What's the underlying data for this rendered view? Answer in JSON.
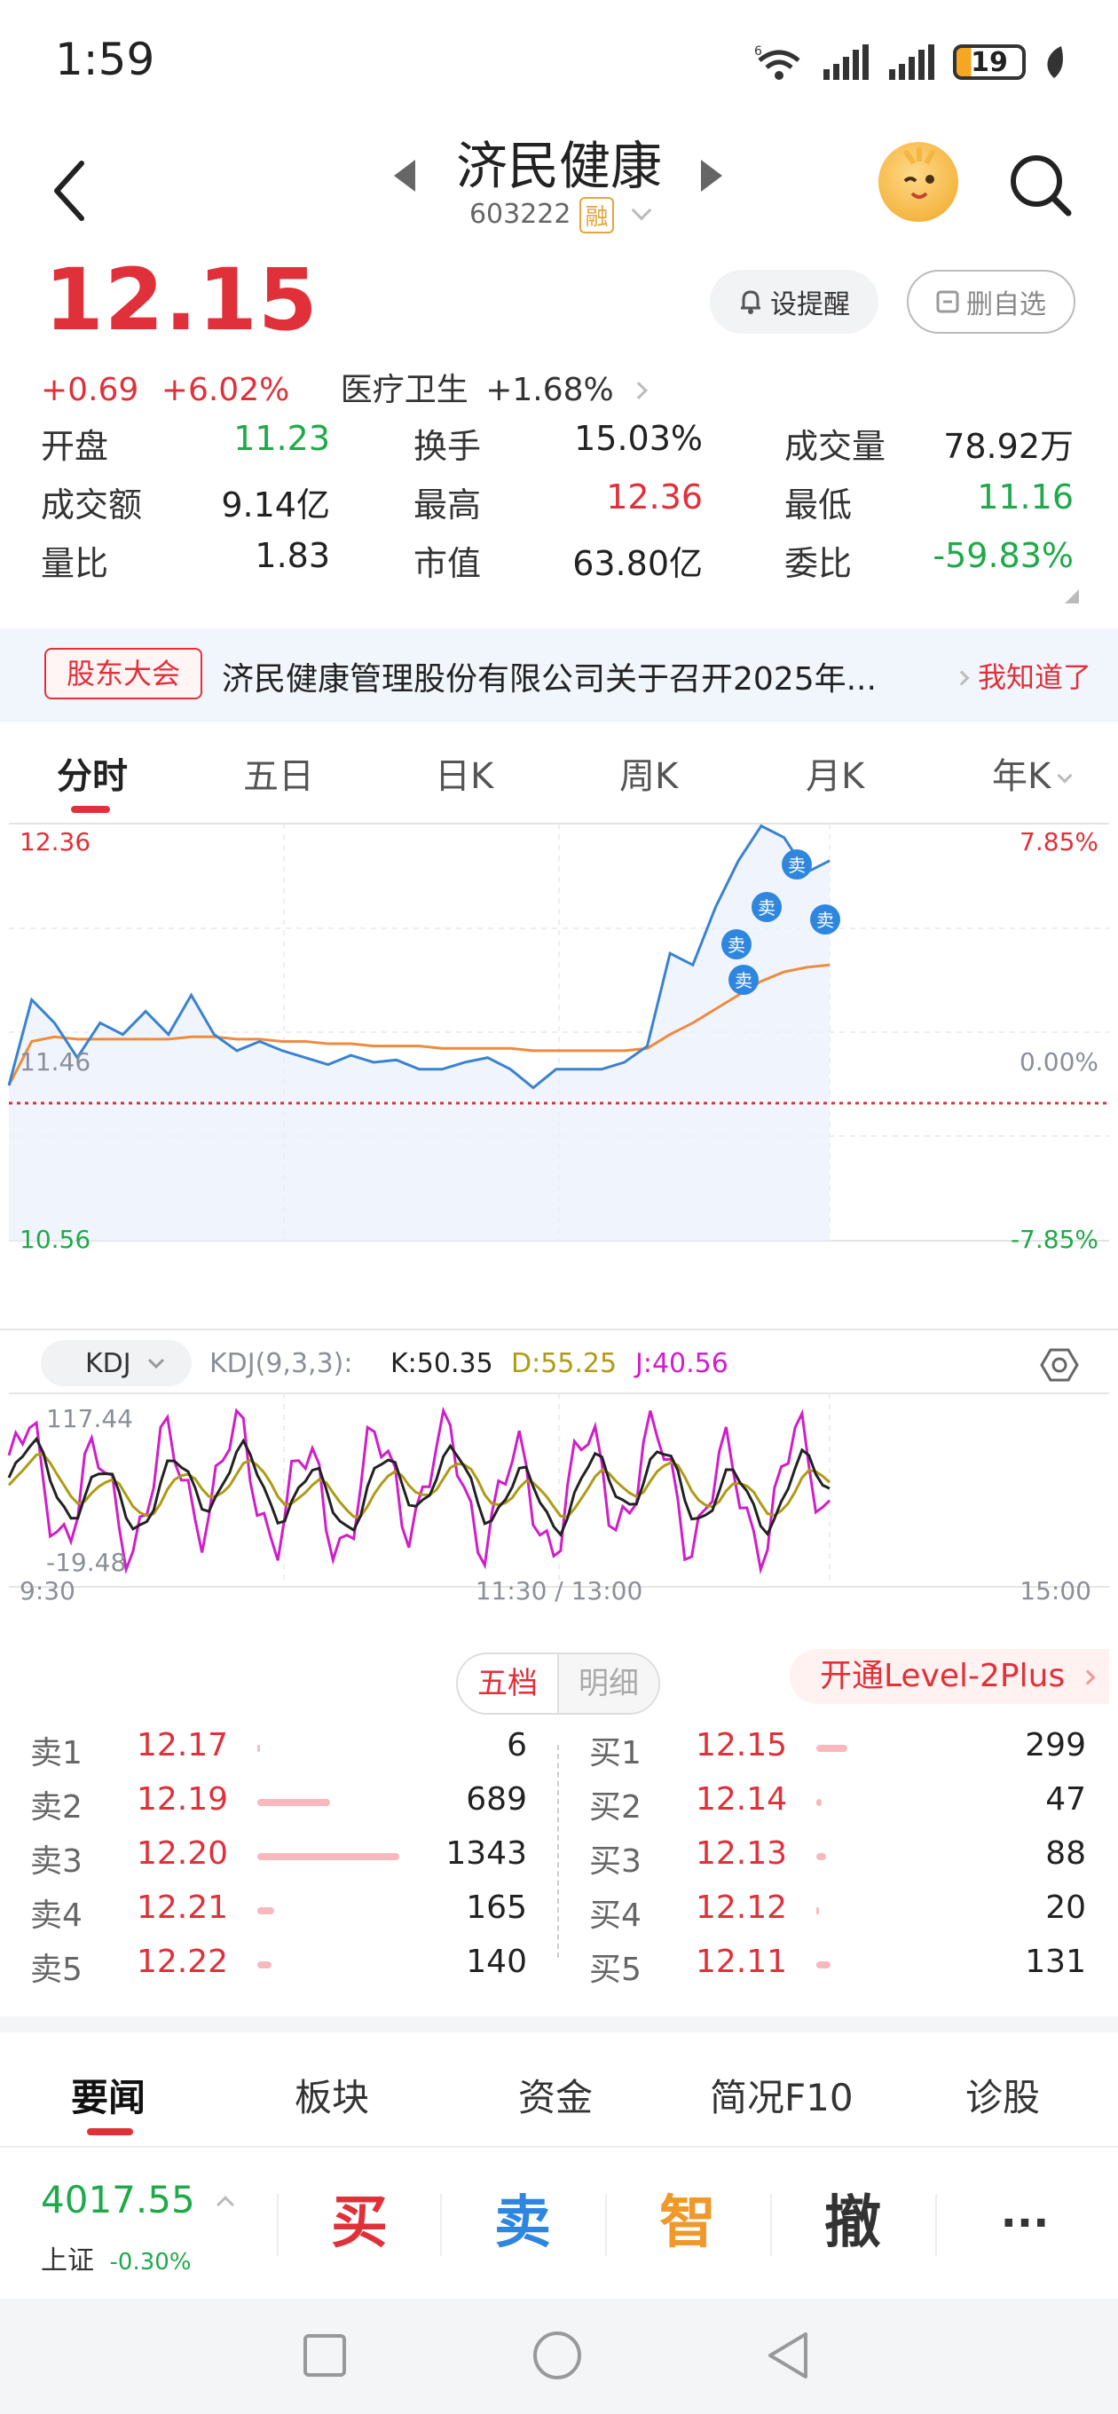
{
  "status_bar": {
    "time": "1:59",
    "network": "6",
    "battery": "19"
  },
  "header": {
    "title": "济民健康",
    "code": "603222",
    "margin_tag": "融"
  },
  "quote": {
    "price": "12.15",
    "change": "+0.69",
    "change_pct": "+6.02%",
    "sector": "医疗卫生",
    "sector_change": "+1.68%",
    "remind_label": "设提醒",
    "delete_label": "删自选"
  },
  "stats": [
    [
      {
        "label": "开盘",
        "value": "11.23",
        "color": "green"
      },
      {
        "label": "换手",
        "value": "15.03%",
        "color": "black"
      },
      {
        "label": "成交量",
        "value": "78.92万",
        "color": "black"
      }
    ],
    [
      {
        "label": "成交额",
        "value": "9.14亿",
        "color": "black"
      },
      {
        "label": "最高",
        "value": "12.36",
        "color": "red"
      },
      {
        "label": "最低",
        "value": "11.16",
        "color": "green"
      }
    ],
    [
      {
        "label": "量比",
        "value": "1.83",
        "color": "black"
      },
      {
        "label": "市值",
        "value": "63.80亿",
        "color": "black"
      },
      {
        "label": "委比",
        "value": "-59.83%",
        "color": "green"
      }
    ]
  ],
  "notice": {
    "tag": "股东大会",
    "text": "济民健康管理股份有限公司关于召开2025年...",
    "ack": "我知道了"
  },
  "period_tabs": [
    "分时",
    "五日",
    "日K",
    "周K",
    "月K",
    "年K"
  ],
  "chart": {
    "price_high": "12.36",
    "price_low": "10.56",
    "pct_high": "7.85%",
    "pct_low": "-7.85%",
    "pct_mid": "0.00%",
    "mid_price": "11.46",
    "indicator_name": "KDJ",
    "indicator_params": "KDJ(9,3,3):",
    "k_text": "K:50.35",
    "d_text": "D:55.25",
    "j_text": "J:40.56",
    "kdj_high": "117.44",
    "kdj_low": "-19.48",
    "time_start": "9:30",
    "time_mid": "11:30 / 13:00",
    "time_end": "15:00",
    "sell_marker": "卖"
  },
  "chart_data": {
    "type": "line",
    "title": "",
    "x_range": [
      "9:30",
      "15:00"
    ],
    "ylim": [
      10.56,
      12.36
    ],
    "prev_close": 11.46,
    "series": [
      {
        "name": "",
        "values": [
          11.23,
          11.6,
          11.5,
          11.35,
          11.5,
          11.45,
          11.55,
          11.45,
          11.62,
          11.45,
          11.38,
          11.42,
          11.38,
          11.35,
          11.32,
          11.36,
          11.33,
          11.34,
          11.3,
          11.3,
          11.33,
          11.35,
          11.3,
          11.22,
          11.3,
          11.3,
          11.3,
          11.33,
          11.4,
          11.8,
          11.75,
          12.0,
          12.2,
          12.35,
          12.3,
          12.15,
          12.2
        ]
      },
      {
        "name": "",
        "values": [
          11.23,
          11.42,
          11.44,
          11.43,
          11.43,
          11.43,
          11.43,
          11.43,
          11.44,
          11.44,
          11.43,
          11.43,
          11.42,
          11.42,
          11.41,
          11.41,
          11.4,
          11.4,
          11.4,
          11.39,
          11.39,
          11.39,
          11.39,
          11.38,
          11.38,
          11.38,
          11.38,
          11.38,
          11.39,
          11.45,
          11.5,
          11.56,
          11.62,
          11.68,
          11.72,
          11.74,
          11.75
        ]
      }
    ],
    "kdj": {
      "K": 50.35,
      "D": 55.25,
      "J": 40.56,
      "ylim": [
        -19.48,
        117.44
      ]
    }
  },
  "order_book": {
    "tab_active": "五档",
    "tab_other": "明细",
    "level2": "开通Level-2Plus",
    "sells": [
      {
        "label": "卖1",
        "price": "12.17",
        "volume": "6",
        "bar": 0.005
      },
      {
        "label": "卖2",
        "price": "12.19",
        "volume": "689",
        "bar": 0.51
      },
      {
        "label": "卖3",
        "price": "12.20",
        "volume": "1343",
        "bar": 1.0
      },
      {
        "label": "卖4",
        "price": "12.21",
        "volume": "165",
        "bar": 0.12
      },
      {
        "label": "卖5",
        "price": "12.22",
        "volume": "140",
        "bar": 0.1
      }
    ],
    "buys": [
      {
        "label": "买1",
        "price": "12.15",
        "volume": "299",
        "bar": 0.22
      },
      {
        "label": "买2",
        "price": "12.14",
        "volume": "47",
        "bar": 0.035
      },
      {
        "label": "买3",
        "price": "12.13",
        "volume": "88",
        "bar": 0.066
      },
      {
        "label": "买4",
        "price": "12.12",
        "volume": "20",
        "bar": 0.015
      },
      {
        "label": "买5",
        "price": "12.11",
        "volume": "131",
        "bar": 0.098
      }
    ]
  },
  "news_tabs": [
    "要闻",
    "板块",
    "资金",
    "简况F10",
    "诊股"
  ],
  "trade_bar": {
    "index_value": "4017.55",
    "index_name": "上证",
    "index_change": "-0.30%",
    "buy": "买",
    "sell": "卖",
    "smart": "智",
    "cancel": "撤",
    "more": "···"
  }
}
